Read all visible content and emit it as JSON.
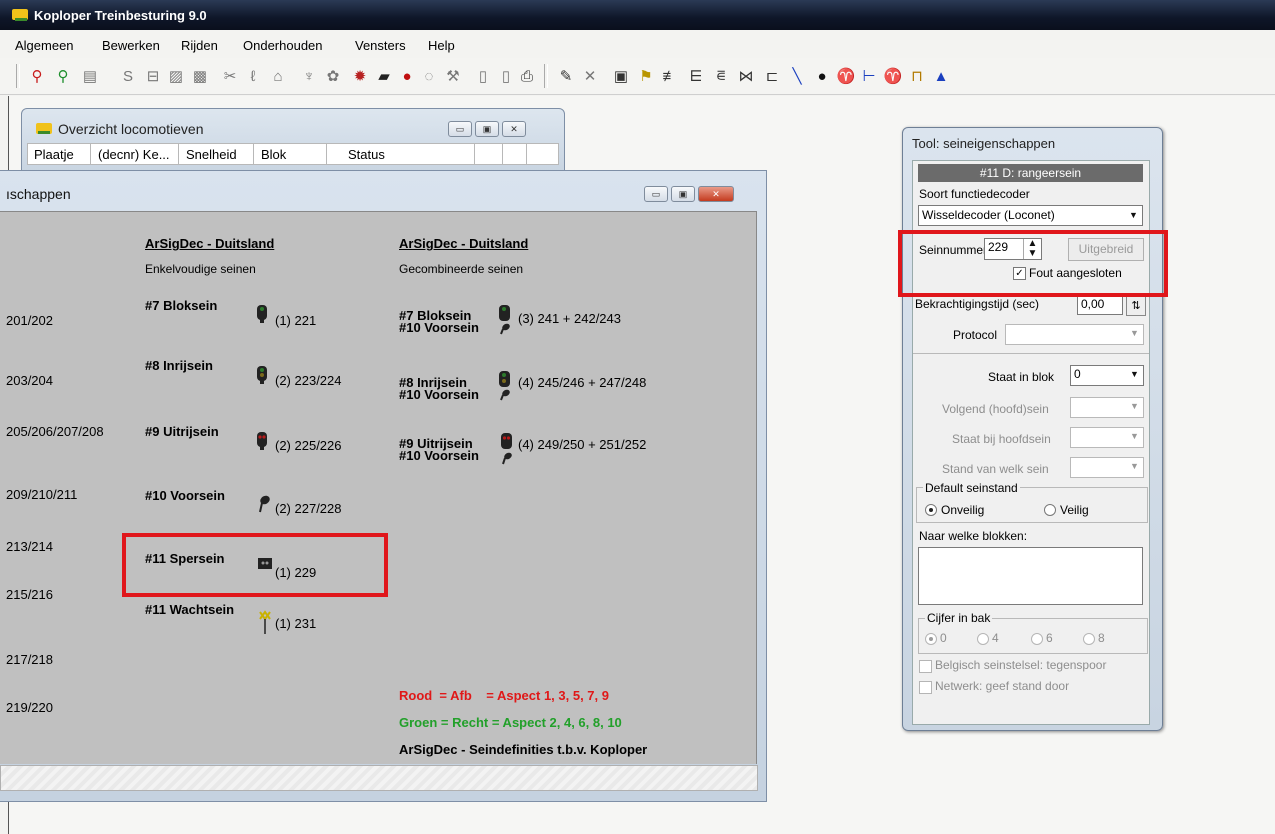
{
  "app": {
    "title": "Koploper Treinbesturing 9.0"
  },
  "menu": [
    "Algemeen",
    "Bewerken",
    "Rijden",
    "Onderhouden",
    "Vensters",
    "Help"
  ],
  "toolbar_icons": [
    "signal-red-icon",
    "signal-green-icon",
    "monitor-icon",
    "s-icon",
    "route-icon",
    "edit-icon",
    "grid-icon",
    "scissors-icon",
    "curve-icon",
    "bell-icon",
    "tree-icon",
    "flower-icon",
    "gear-icon",
    "loco-icon",
    "stop-icon",
    "clock-icon",
    "wrench-icon",
    "page-icon",
    "page2-icon",
    "print-icon",
    "pencil-icon",
    "delete-icon",
    "save-icon",
    "tools-icon",
    "rail-icon",
    "track-icon",
    "switch-icon",
    "junction-icon",
    "crossing-icon",
    "line-icon",
    "signal-icon",
    "signal2-icon",
    "signal3-icon",
    "signal4-icon",
    "signal5-icon",
    "signal6-icon"
  ],
  "loco_window": {
    "title": "Overzicht locomotieven",
    "columns": [
      "Plaatje",
      "(decnr) Ke...",
      "Snelheid",
      "Blok",
      "Status"
    ]
  },
  "signal_window": {
    "title": "ıschappen",
    "addresses": [
      "201/202",
      "203/204",
      "205/206/207/208",
      "209/210/211",
      "213/214",
      "215/216",
      "217/218",
      "219/220"
    ],
    "col1_header": "ArSigDec - Duitsland",
    "col1_sub": "Enkelvoudige seinen",
    "col2_header": "ArSigDec - Duitsland",
    "col2_sub": "Gecombineerde seinen",
    "single": [
      {
        "label": "#7  Bloksein",
        "num": "(1)  221"
      },
      {
        "label": "#8  Inrijsein",
        "num": "(2)  223/224"
      },
      {
        "label": "#9  Uitrijsein",
        "num": "(2)  225/226"
      },
      {
        "label": "#10 Voorsein",
        "num": "(2)  227/228"
      },
      {
        "label": "#11 Spersein",
        "num": "(1)  229"
      },
      {
        "label": "#11 Wachtsein",
        "num": "(1)  231"
      }
    ],
    "combined": [
      {
        "line1": "#7  Bloksein",
        "line2": "#10 Voorsein",
        "num": "(3)  241 + 242/243"
      },
      {
        "line1": "#8  Inrijsein",
        "line2": "#10 Voorsein",
        "num": "(4)  245/246 + 247/248"
      },
      {
        "line1": "#9  Uitrijsein",
        "line2": "#10 Voorsein",
        "num": "(4)  249/250 + 251/252"
      }
    ],
    "legend_red": "Rood  = Afb    = Aspect 1, 3, 5, 7, 9",
    "legend_green": "Groen = Recht = Aspect 2, 4, 6, 8, 10",
    "footer": "ArSigDec - Seindefinities t.b.v. Koploper"
  },
  "tool": {
    "title": "Tool: seineigenschappen",
    "header": "#11 D: rangeersein",
    "decoder_label": "Soort functiedecoder",
    "decoder_value": "Wisseldecoder (Loconet)",
    "seinnummer_label": "Seinnummer",
    "seinnummer_value": "229",
    "uitgebreid": "Uitgebreid",
    "fout": "Fout aangesloten",
    "bekrachtiging_label": "Bekrachtigingstijd (sec)",
    "bekrachtiging_value": "0,00",
    "protocol_label": "Protocol",
    "staat_label": "Staat in blok",
    "staat_value": "0",
    "volgend_label": "Volgend (hoofd)sein",
    "bij_label": "Staat bij hoofdsein",
    "stand_label": "Stand van welk sein",
    "default_label": "Default seinstand",
    "onveilig": "Onveilig",
    "veilig": "Veilig",
    "naar_label": "Naar welke blokken:",
    "cijfer_label": "Cijfer in bak",
    "cijfers": [
      "0",
      "4",
      "6",
      "8"
    ],
    "belgisch": "Belgisch seinstelsel: tegenspoor",
    "netwerk": "Netwerk: geef stand door"
  }
}
